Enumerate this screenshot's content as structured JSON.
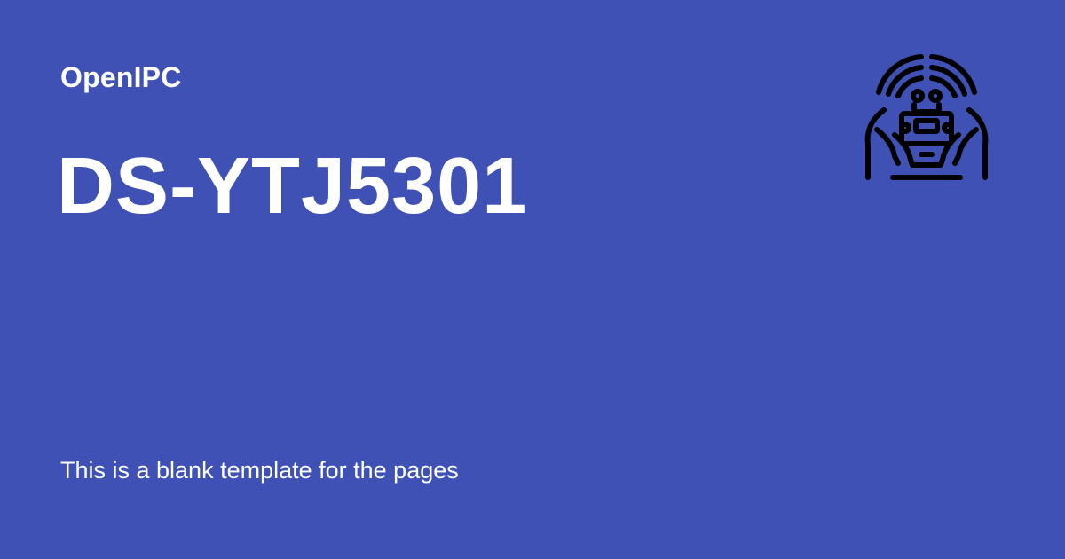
{
  "colors": {
    "background": "#3f51b5",
    "text": "#ffffff",
    "logo": "#000000"
  },
  "header": {
    "site_name": "OpenIPC"
  },
  "main": {
    "title": "DS-YTJ5301",
    "description": "This is a blank template for the pages"
  },
  "logo": {
    "icon": "hands-holding-device-icon"
  }
}
